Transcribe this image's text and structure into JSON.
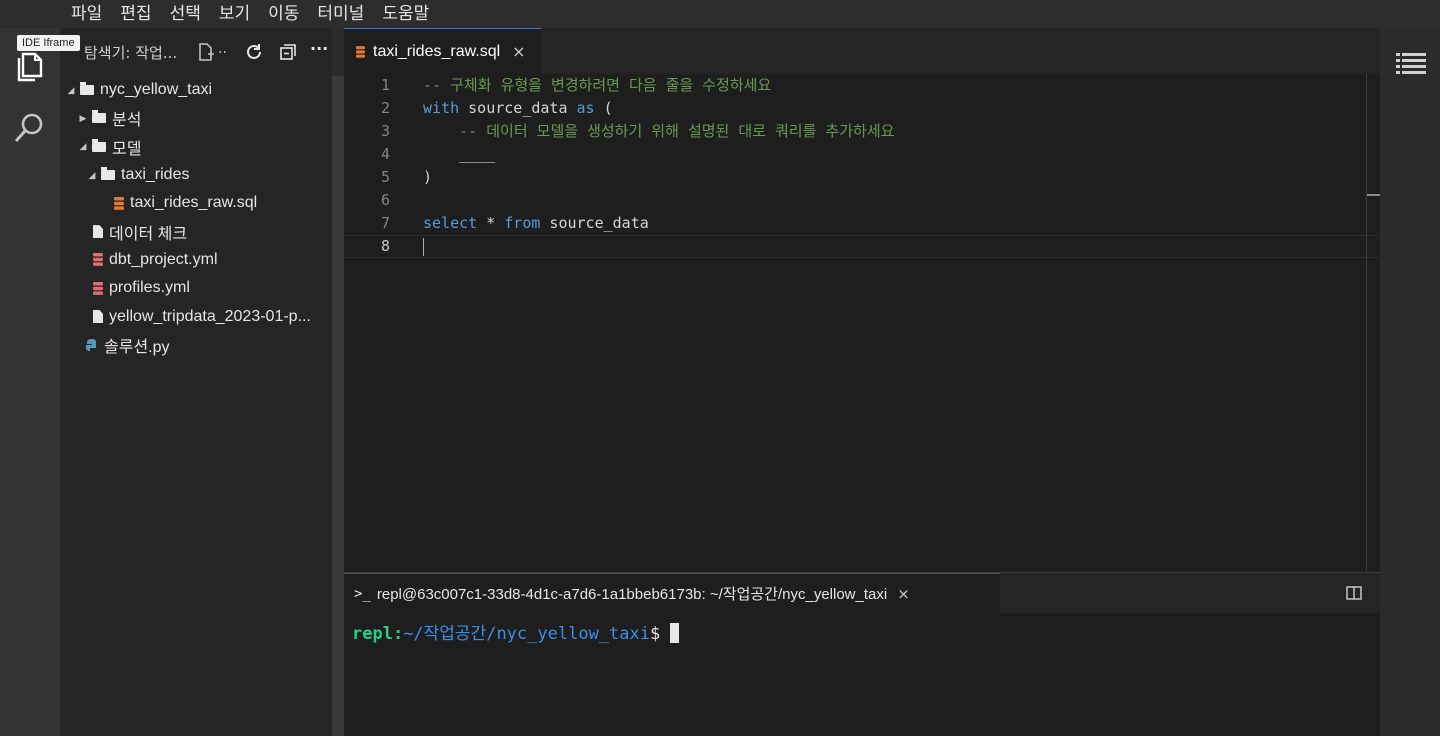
{
  "menu": [
    "파일",
    "편집",
    "선택",
    "보기",
    "이동",
    "터미널",
    "도움말"
  ],
  "tooltip": "IDE Iframe",
  "sidebar": {
    "title": "탐색기: 작업...",
    "tree": [
      {
        "label": "nyc_yellow_taxi",
        "type": "folder",
        "expanded": true,
        "depth": 0
      },
      {
        "label": "분석",
        "type": "folder",
        "expanded": false,
        "depth": 1
      },
      {
        "label": "모델",
        "type": "folder",
        "expanded": true,
        "depth": 1
      },
      {
        "label": "taxi_rides",
        "type": "folder",
        "expanded": true,
        "depth": 2
      },
      {
        "label": "taxi_rides_raw.sql",
        "type": "sql",
        "depth": 3
      },
      {
        "label": "데이터 체크",
        "type": "file",
        "depth": 2
      },
      {
        "label": "dbt_project.yml",
        "type": "yml",
        "depth": 2
      },
      {
        "label": "profiles.yml",
        "type": "yml",
        "depth": 2
      },
      {
        "label": "yellow_tripdata_2023-01-p...",
        "type": "file",
        "depth": 2
      },
      {
        "label": "솔루션.py",
        "type": "python",
        "depth": 1
      }
    ]
  },
  "editor": {
    "tab_label": "taxi_rides_raw.sql",
    "tab_close": "×",
    "line_numbers": [
      "1",
      "2",
      "3",
      "4",
      "5",
      "6",
      "7",
      "8"
    ],
    "lines": {
      "l1_comment": "-- 구체화 유형을 변경하려면 다음 줄을 수정하세요",
      "l2_kw1": "with",
      "l2_id": " source_data ",
      "l2_kw2": "as",
      "l2_paren": " (",
      "l3_comment": "    -- 데이터 모델을 생성하기 위해 설명된 대로 쿼리를 추가하세요",
      "l4_blank": "    ____",
      "l5": ")",
      "l7_kw1": "select",
      "l7_star": " * ",
      "l7_kw2": "from",
      "l7_id": " source_data"
    }
  },
  "terminal": {
    "tab_label": "repl@63c007c1-33d8-4d1c-a7d6-1a1bbeb6173b: ~/작업공간/nyc_yellow_taxi",
    "tab_close": "×",
    "prompt_user": "repl:",
    "prompt_path": "~/작업공간/nyc_yellow_taxi",
    "prompt_dollar": "$"
  },
  "colors": {
    "keyword": "#569cd6",
    "comment": "#6a9955",
    "prompt_user": "#23d18b",
    "prompt_path": "#3b8eea",
    "sql_icon": "#e37933",
    "yml_icon": "#e06c75",
    "python_icon": "#519aba"
  }
}
